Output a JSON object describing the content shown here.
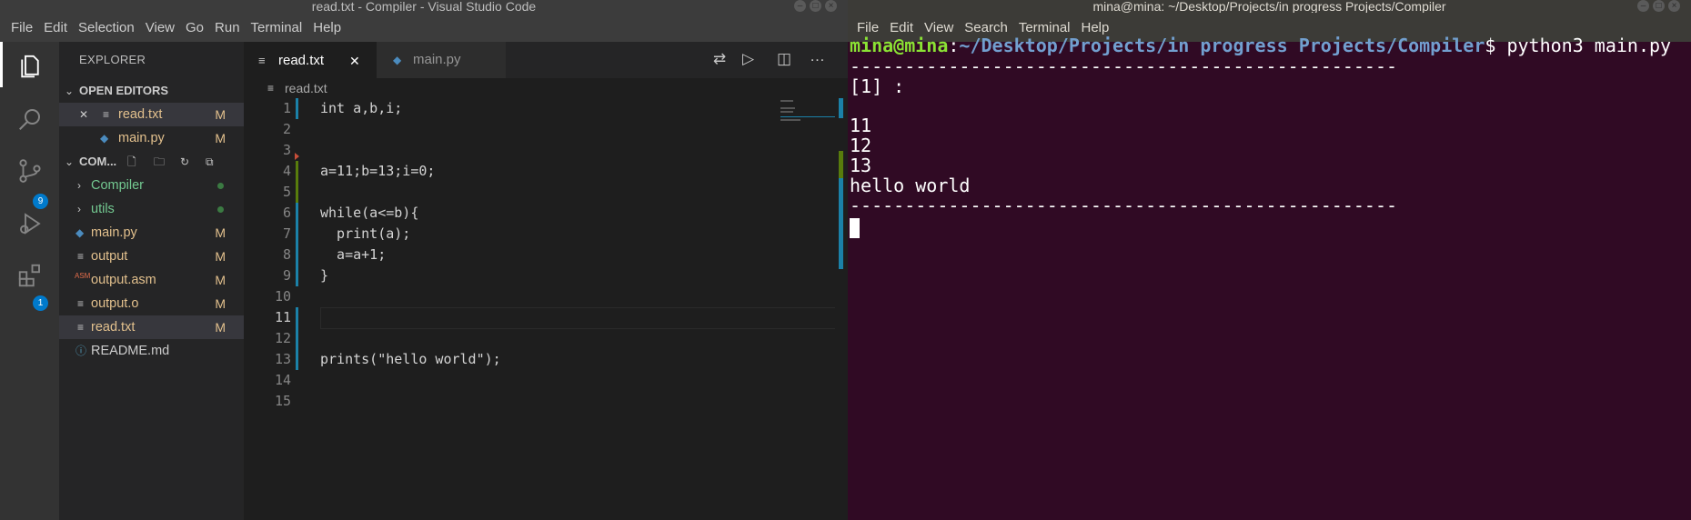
{
  "vscode": {
    "title": "read.txt - Compiler - Visual Studio Code",
    "menu": [
      "File",
      "Edit",
      "Selection",
      "View",
      "Go",
      "Run",
      "Terminal",
      "Help"
    ],
    "activity_badges": {
      "source_control": "9",
      "extensions": "1"
    },
    "sidebar": {
      "header": "EXPLORER",
      "open_editors_label": "OPEN EDITORS",
      "open_editors": [
        {
          "name": "read.txt",
          "status": "M"
        },
        {
          "name": "main.py",
          "status": "M"
        }
      ],
      "folder_label": "COM...",
      "tree": [
        {
          "name": "Compiler",
          "type": "folder"
        },
        {
          "name": "utils",
          "type": "folder"
        },
        {
          "name": "main.py",
          "status": "M"
        },
        {
          "name": "output",
          "status": "M"
        },
        {
          "name": "output.asm",
          "status": "M",
          "icon_text": "ASM"
        },
        {
          "name": "output.o",
          "status": "M"
        },
        {
          "name": "read.txt",
          "status": "M"
        },
        {
          "name": "README.md",
          "status": ""
        }
      ]
    },
    "tabs": [
      {
        "label": "read.txt",
        "active": true
      },
      {
        "label": "main.py",
        "active": false
      }
    ],
    "breadcrumb": "read.txt",
    "code_lines": [
      {
        "n": "1",
        "text": "int a,b,i;"
      },
      {
        "n": "2",
        "text": ""
      },
      {
        "n": "3",
        "text": ""
      },
      {
        "n": "4",
        "text": "a=11;b=13;i=0;"
      },
      {
        "n": "5",
        "text": ""
      },
      {
        "n": "6",
        "text": "while(a<=b){"
      },
      {
        "n": "7",
        "text": "  print(a);"
      },
      {
        "n": "8",
        "text": "  a=a+1;"
      },
      {
        "n": "9",
        "text": "}"
      },
      {
        "n": "10",
        "text": ""
      },
      {
        "n": "11",
        "text": ""
      },
      {
        "n": "12",
        "text": ""
      },
      {
        "n": "13",
        "text": "prints(\"hello world\");"
      },
      {
        "n": "14",
        "text": ""
      },
      {
        "n": "15",
        "text": ""
      }
    ]
  },
  "terminal": {
    "title": "mina@mina: ~/Desktop/Projects/in progress Projects/Compiler",
    "menu": [
      "File",
      "Edit",
      "View",
      "Search",
      "Terminal",
      "Help"
    ],
    "prompt_user": "mina@mina",
    "prompt_sep": ":",
    "prompt_path": "~/Desktop/Projects/in progress Projects/Compiler",
    "prompt_cmd": "$ python3 main.py",
    "output": [
      "--------------------------------------------------",
      "[1] :",
      "",
      "11",
      "12",
      "13",
      "hello world",
      "--------------------------------------------------"
    ]
  },
  "colors": {
    "vscode_accent": "#007acc",
    "modified": "#e2c08d",
    "folder_green": "#73c991",
    "terminal_bg": "#300a24",
    "prompt_user": "#8ae234",
    "prompt_path": "#729fcf"
  }
}
